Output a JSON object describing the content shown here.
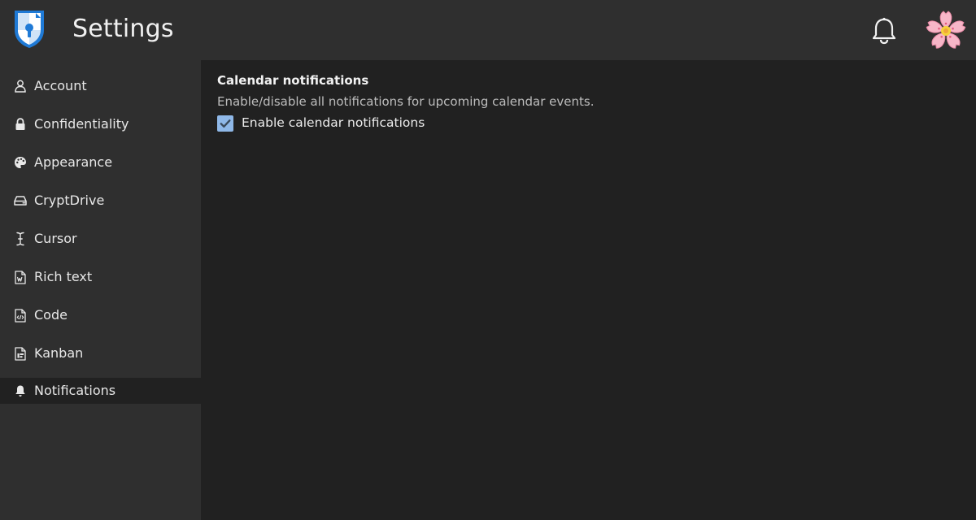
{
  "header": {
    "title": "Settings",
    "logo_icon": "shield-keyhole-icon",
    "notifications_icon": "bell-icon",
    "avatar_icon": "cherry-blossom-avatar"
  },
  "sidebar": {
    "items": [
      {
        "label": "Account",
        "icon": "user-icon",
        "active": false
      },
      {
        "label": "Confidentiality",
        "icon": "lock-icon",
        "active": false
      },
      {
        "label": "Appearance",
        "icon": "palette-icon",
        "active": false
      },
      {
        "label": "CryptDrive",
        "icon": "drive-icon",
        "active": false
      },
      {
        "label": "Cursor",
        "icon": "text-cursor-icon",
        "active": false
      },
      {
        "label": "Rich text",
        "icon": "word-document-icon",
        "active": false
      },
      {
        "label": "Code",
        "icon": "code-document-icon",
        "active": false
      },
      {
        "label": "Kanban",
        "icon": "kanban-document-icon",
        "active": false
      },
      {
        "label": "Notifications",
        "icon": "bell-icon",
        "active": true
      }
    ]
  },
  "main": {
    "section_title": "Calendar notifications",
    "section_description": "Enable/disable all notifications for upcoming calendar events.",
    "checkbox_label": "Enable calendar notifications",
    "checkbox_checked": true
  },
  "colors": {
    "background": "#212121",
    "panel": "#2f2f2f",
    "accent": "#8fb8e8",
    "brand": "#1f7ad6"
  }
}
